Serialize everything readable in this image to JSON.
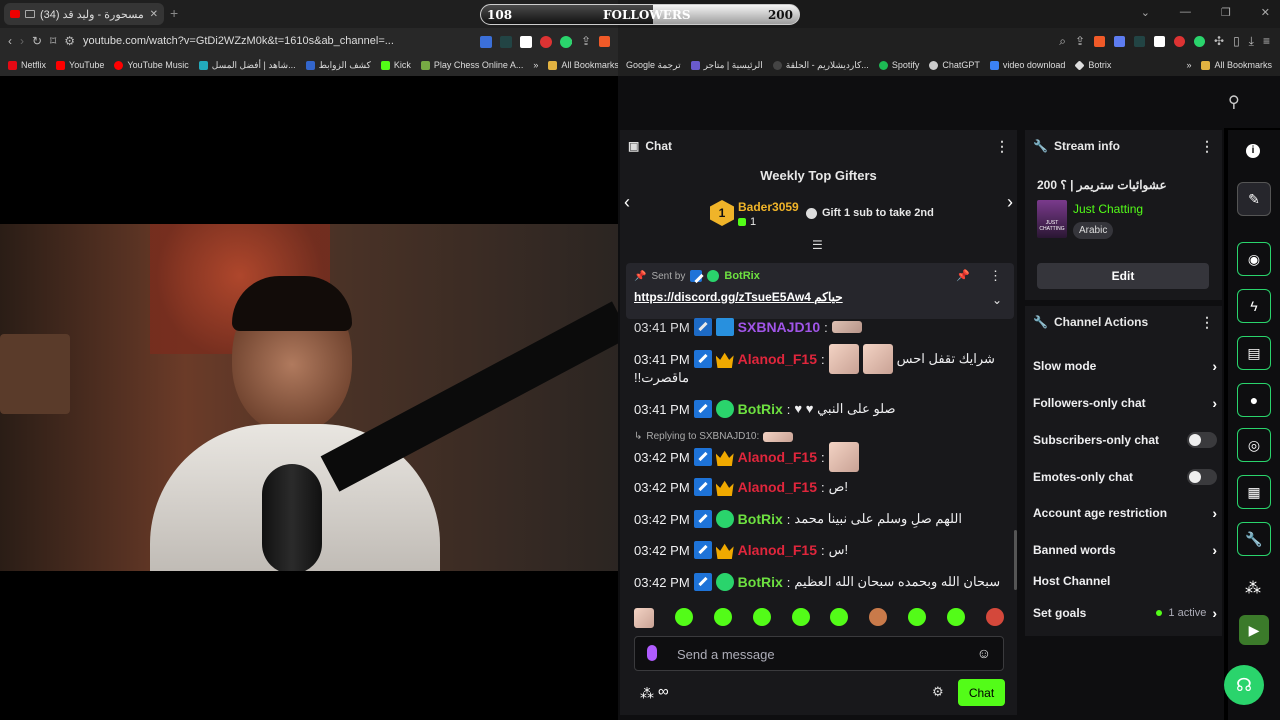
{
  "browser_left": {
    "tab_title": "(34) حمولة مسحورة - وليد قد...",
    "tab_close": "✕",
    "new_tab": "+",
    "url": "youtube.com/watch?v=GtDi2WZzM0k&t=1610s&ab_channel=...",
    "bookmarks": [
      "Netflix",
      "YouTube",
      "YouTube Music",
      "شاهد | أفضل المسل...",
      "كشف الزوابط",
      "Kick",
      "Play Chess Online A..."
    ],
    "more": "»",
    "all_bookmarks": "All Bookmarks"
  },
  "browser_right": {
    "bookmarks": [
      "Google ترجمة",
      "الرئيسية | متاجر",
      "كارديشلاريم - الحلقة...",
      "Spotify",
      "ChatGPT",
      "video download",
      "Botrix"
    ],
    "more": "»",
    "all_bookmarks": "All Bookmarks",
    "window_controls": [
      "⌄",
      "—",
      "❐",
      "✕"
    ]
  },
  "followers_bar": {
    "current": "108",
    "label": "FOLLOWERS",
    "goal": "200",
    "progress": 0.54
  },
  "chat": {
    "title": "Chat",
    "gifters_title": "Weekly Top Gifters",
    "top_gifter": {
      "rank": "1",
      "name": "Bader3059",
      "count": "1"
    },
    "gift_cta": "Gift 1 sub to take 2nd",
    "pinned": {
      "sent_by_label": "Sent by",
      "sender": "BotRix",
      "text": "https://discord.gg/zTsueE5Aw4 حياكم"
    },
    "messages": [
      {
        "time": "03:41 PM",
        "user": "SXBNAJD10",
        "color": "#b05cff",
        "text": ""
      },
      {
        "time": "03:41 PM",
        "user": "Alanod_F15",
        "color": "#e0263c",
        "text": "شرايك تقفل احس"
      },
      {
        "time": "",
        "user": "",
        "color": "#efeff1",
        "text": "!!ماقصرت"
      },
      {
        "time": "03:41 PM",
        "user": "BotRix",
        "color": "#6de040",
        "text": "♥ ♥ صلو على النبي"
      },
      {
        "time": "03:42 PM",
        "user": "Alanod_F15",
        "color": "#e0263c",
        "text": ""
      },
      {
        "time": "03:42 PM",
        "user": "Alanod_F15",
        "color": "#e0263c",
        "text": "ص!"
      },
      {
        "time": "03:42 PM",
        "user": "BotRix",
        "color": "#6de040",
        "text": "اللهم صلِ وسلم على نبينا محمد"
      },
      {
        "time": "03:42 PM",
        "user": "Alanod_F15",
        "color": "#e0263c",
        "text": "س!"
      },
      {
        "time": "03:42 PM",
        "user": "BotRix",
        "color": "#6de040",
        "text": "سبحان الله وبحمده سبحان الله العظيم"
      }
    ],
    "reply_label": "Replying to SXBNAJD10:",
    "input_placeholder": "Send a message",
    "chat_button": "Chat",
    "infinity": "∞"
  },
  "stream_info": {
    "title": "Stream info",
    "stream_title": "عشوائيات ستريمر | ؟ 200",
    "category": "Just Chatting",
    "tag": "Arabic",
    "edit_button": "Edit",
    "category_thumb": "JUST CHATTING"
  },
  "channel_actions": {
    "title": "Channel Actions",
    "items": [
      {
        "label": "Slow mode",
        "control": "chevron"
      },
      {
        "label": "Followers-only chat",
        "control": "chevron"
      },
      {
        "label": "Subscribers-only chat",
        "control": "toggle"
      },
      {
        "label": "Emotes-only chat",
        "control": "toggle"
      },
      {
        "label": "Account age restriction",
        "control": "chevron"
      },
      {
        "label": "Banned words",
        "control": "chevron"
      },
      {
        "label": "Host Channel",
        "control": "none"
      },
      {
        "label": "Set goals",
        "control": "chevron"
      }
    ],
    "goals_status": "1 active"
  },
  "colors": {
    "accent": "#53fc18",
    "mod": "#1e73d8",
    "vip": "#f0a900",
    "panel": "#18181b"
  }
}
